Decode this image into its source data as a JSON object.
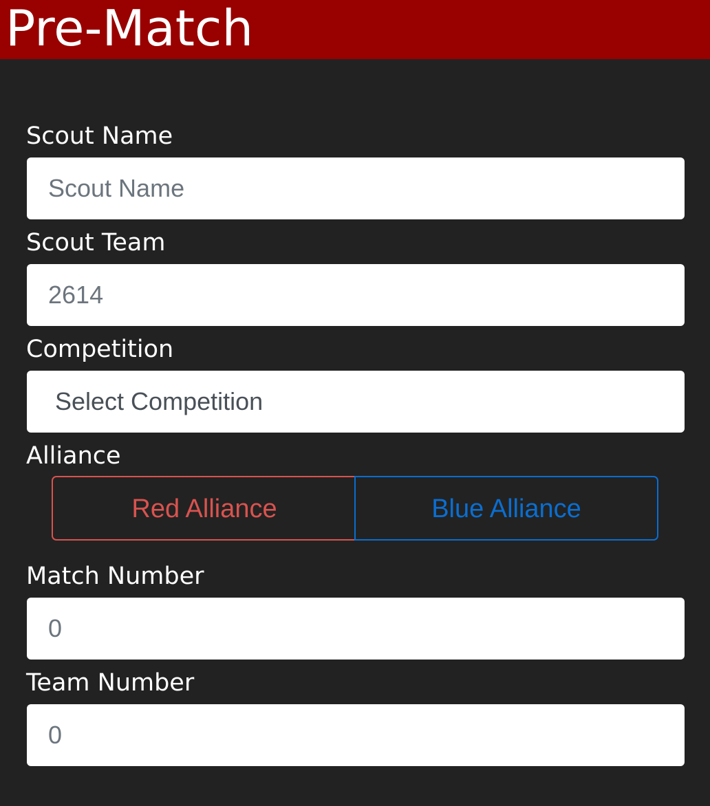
{
  "header": {
    "title": "Pre-Match"
  },
  "form": {
    "scout_name": {
      "label": "Scout Name",
      "placeholder": "Scout Name",
      "value": ""
    },
    "scout_team": {
      "label": "Scout Team",
      "placeholder": "2614",
      "value": ""
    },
    "competition": {
      "label": "Competition",
      "selected": "Select Competition"
    },
    "alliance": {
      "label": "Alliance",
      "red_label": "Red Alliance",
      "blue_label": "Blue Alliance"
    },
    "match_number": {
      "label": "Match Number",
      "placeholder": "0",
      "value": ""
    },
    "team_number": {
      "label": "Team Number",
      "placeholder": "0",
      "value": ""
    }
  },
  "colors": {
    "header_bg": "#990000",
    "page_bg": "#222222",
    "red_alliance": "#d9534f",
    "blue_alliance": "#0a6ed1"
  }
}
